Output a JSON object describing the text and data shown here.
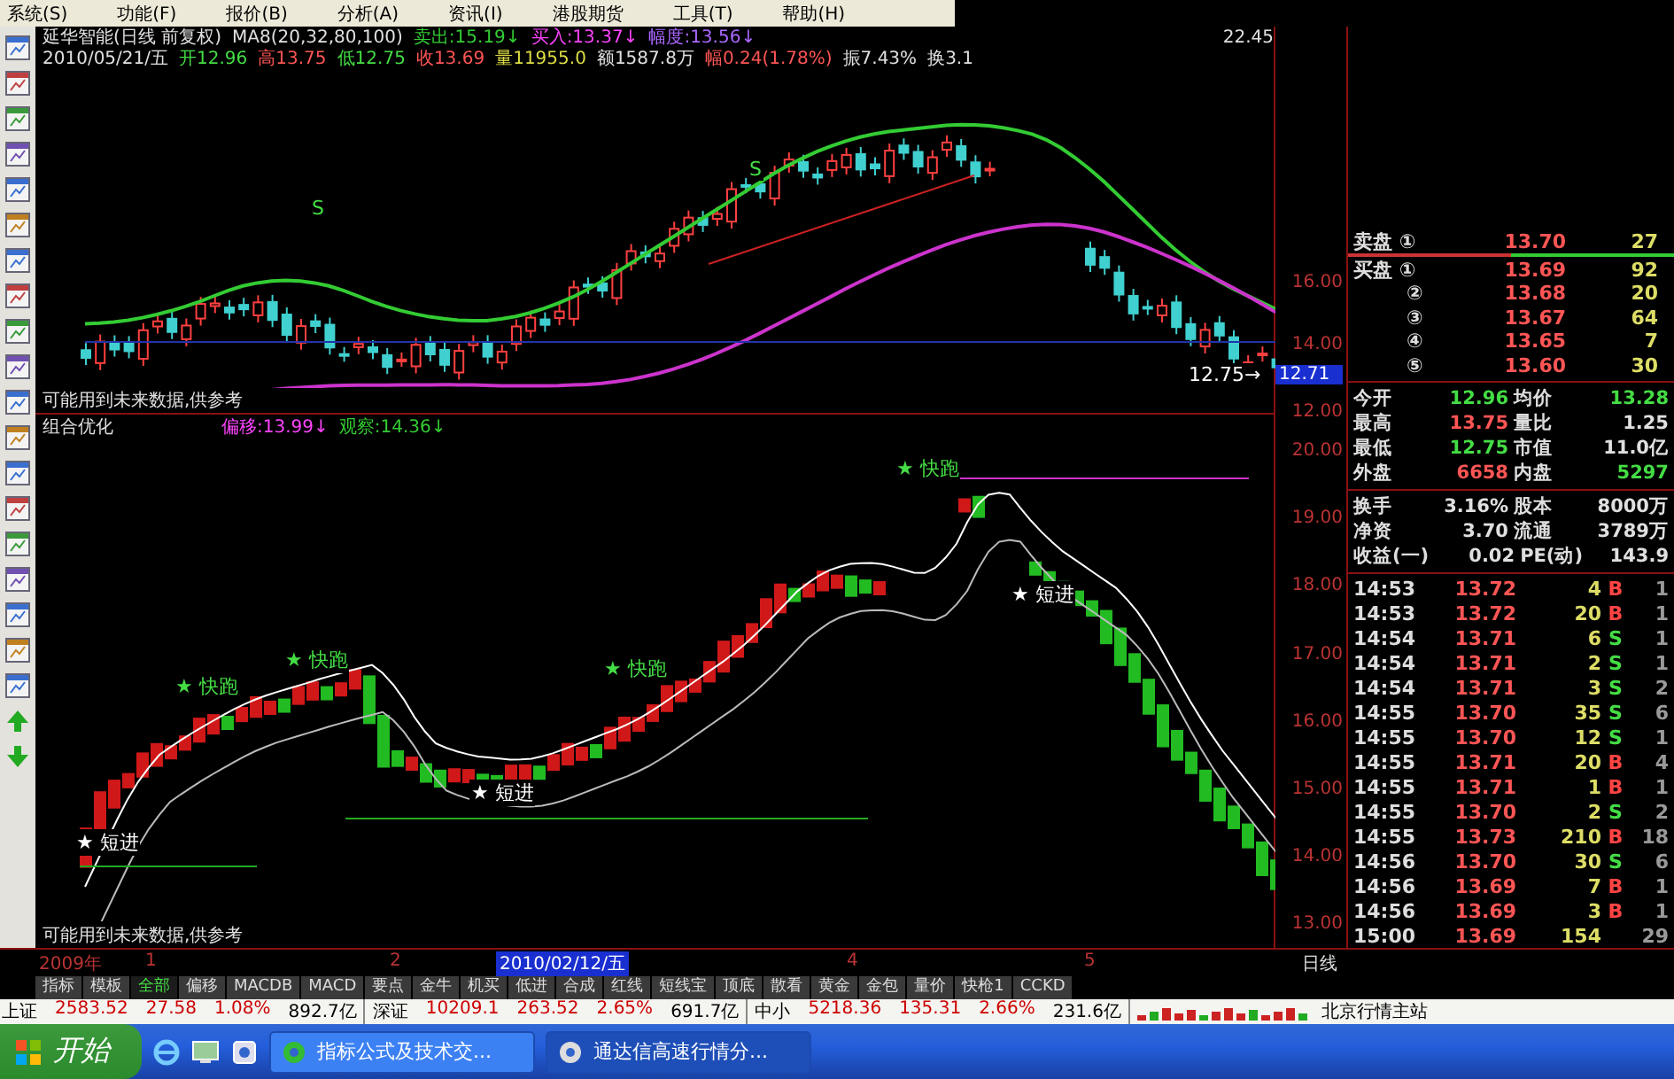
{
  "menu": [
    {
      "label": "系统(S)"
    },
    {
      "label": "功能(F)"
    },
    {
      "label": "报价(B)"
    },
    {
      "label": "分析(A)"
    },
    {
      "label": "资讯(I)"
    },
    {
      "label": "港股期货"
    },
    {
      "label": "工具(T)"
    },
    {
      "label": "帮助(H)"
    }
  ],
  "chart_header": {
    "title": "延华智能(日线 前复权)",
    "indicator": "MA8(20,32,80,100)",
    "signals": [
      {
        "label": "卖出:15.19↓",
        "color": "#33cc33"
      },
      {
        "label": "买入:13.37↓",
        "color": "#ff44ff"
      },
      {
        "label": "幅度:13.56↓",
        "color": "#aa66ff"
      }
    ],
    "time": "22.45"
  },
  "quote_line": [
    {
      "label": "2010/05/21/五",
      "color": "#e0e0e0"
    },
    {
      "label": "开12.96",
      "color": "#44dd44"
    },
    {
      "label": "高13.75",
      "color": "#ff5555"
    },
    {
      "label": "低12.75",
      "color": "#44dd44"
    },
    {
      "label": "收13.69",
      "color": "#ff5555"
    },
    {
      "label": "量11955.0",
      "color": "#dddd44"
    },
    {
      "label": "额1587.8万",
      "color": "#e0e0e0"
    },
    {
      "label": "幅0.24(1.78%)",
      "color": "#ff5555"
    },
    {
      "label": "振7.43%",
      "color": "#e0e0e0"
    },
    {
      "label": "换3.1",
      "color": "#e0e0e0"
    }
  ],
  "upper_chart": {
    "markers": [
      {
        "text": "S"
      },
      {
        "text": "S"
      },
      {
        "text": "12.75→"
      }
    ],
    "note": "可能用到未来数据,供参考"
  },
  "lower_chart": {
    "title": "组合优化",
    "signals": [
      {
        "label": "偏移:13.99↓",
        "color": "#ff44ff"
      },
      {
        "label": "观察:14.36↓",
        "color": "#33cc33"
      }
    ],
    "labels": [
      {
        "text": "★ 快跑",
        "kind": "run"
      },
      {
        "text": "★ 快跑",
        "kind": "run"
      },
      {
        "text": "★ 快跑",
        "kind": "run"
      },
      {
        "text": "★ 快跑",
        "kind": "run"
      },
      {
        "text": "★ 短进",
        "kind": "entry"
      },
      {
        "text": "★ 短进",
        "kind": "entry"
      },
      {
        "text": "★ 短进",
        "kind": "entry"
      }
    ],
    "note": "可能用到未来数据,供参考"
  },
  "price_axis": {
    "upper": [
      {
        "text": "16.00",
        "kind": "tick"
      },
      {
        "text": "14.00",
        "kind": "tick"
      },
      {
        "text": "12.71",
        "kind": "current"
      },
      {
        "text": "12.00",
        "kind": "tick"
      }
    ],
    "lower": [
      {
        "text": "20.00"
      },
      {
        "text": "19.00"
      },
      {
        "text": "18.00"
      },
      {
        "text": "17.00"
      },
      {
        "text": "16.00"
      },
      {
        "text": "15.00"
      },
      {
        "text": "14.00"
      },
      {
        "text": "13.00"
      }
    ]
  },
  "date_axis": [
    {
      "text": "2009年",
      "kind": "tick"
    },
    {
      "text": "1",
      "kind": "tick"
    },
    {
      "text": "2",
      "kind": "tick"
    },
    {
      "text": "2010/02/12/五",
      "kind": "cursor"
    },
    {
      "text": "4",
      "kind": "tick"
    },
    {
      "text": "5",
      "kind": "tick"
    },
    {
      "text": "日线",
      "kind": "period"
    }
  ],
  "tabs": [
    {
      "label": "指标",
      "selected": false
    },
    {
      "label": "模板",
      "selected": false
    },
    {
      "label": "全部",
      "selected": true
    },
    {
      "label": "偏移",
      "selected": false
    },
    {
      "label": "MACDB",
      "selected": false
    },
    {
      "label": "MACD",
      "selected": false
    },
    {
      "label": "要点",
      "selected": false
    },
    {
      "label": "金牛",
      "selected": false
    },
    {
      "label": "机买",
      "selected": false
    },
    {
      "label": "低进",
      "selected": false
    },
    {
      "label": "合成",
      "selected": false
    },
    {
      "label": "红线",
      "selected": false
    },
    {
      "label": "短线宝",
      "selected": false
    },
    {
      "label": "顶底",
      "selected": false
    },
    {
      "label": "散看",
      "selected": false
    },
    {
      "label": "黄金",
      "selected": false
    },
    {
      "label": "金包",
      "selected": false
    },
    {
      "label": "量价",
      "selected": false
    },
    {
      "label": "快枪1",
      "selected": false
    },
    {
      "label": "CCKD",
      "selected": false
    }
  ],
  "quote_panel": {
    "ask": {
      "side": "卖盘",
      "index": "①",
      "price": "13.70",
      "volume": "27"
    },
    "bids": [
      {
        "side": "买盘",
        "index": "①",
        "price": "13.69",
        "volume": "92"
      },
      {
        "index": "②",
        "price": "13.68",
        "volume": "20"
      },
      {
        "index": "③",
        "price": "13.67",
        "volume": "64"
      },
      {
        "index": "④",
        "price": "13.65",
        "volume": "7"
      },
      {
        "index": "⑤",
        "price": "13.60",
        "volume": "30"
      }
    ],
    "stats": [
      [
        {
          "label": "今开",
          "value": "12.96",
          "color": "#44dd44"
        },
        {
          "label": "均价",
          "value": "13.28",
          "color": "#44dd44"
        }
      ],
      [
        {
          "label": "最高",
          "value": "13.75",
          "color": "#ff5555"
        },
        {
          "label": "量比",
          "value": "1.25",
          "color": "#e0e0e0"
        }
      ],
      [
        {
          "label": "最低",
          "value": "12.75",
          "color": "#44dd44"
        },
        {
          "label": "市值",
          "value": "11.0亿",
          "color": "#e0e0e0"
        }
      ],
      [
        {
          "label": "外盘",
          "value": "6658",
          "color": "#ff5555"
        },
        {
          "label": "内盘",
          "value": "5297",
          "color": "#44dd44"
        }
      ]
    ],
    "fundamentals": [
      [
        {
          "label": "换手",
          "value": "3.16%"
        },
        {
          "label": "股本",
          "value": "8000万"
        }
      ],
      [
        {
          "label": "净资",
          "value": "3.70"
        },
        {
          "label": "流通",
          "value": "3789万"
        }
      ],
      [
        {
          "label": "收益(一)",
          "value": "0.02"
        },
        {
          "label": "PE(动)",
          "value": "143.9"
        }
      ]
    ]
  },
  "trades": [
    {
      "time": "14:53",
      "price": "13.72",
      "volume": "4",
      "side": "B",
      "kind": "buy",
      "count": "1"
    },
    {
      "time": "14:53",
      "price": "13.72",
      "volume": "20",
      "side": "B",
      "kind": "buy",
      "count": "1"
    },
    {
      "time": "14:54",
      "price": "13.71",
      "volume": "6",
      "side": "S",
      "kind": "sell",
      "count": "1"
    },
    {
      "time": "14:54",
      "price": "13.71",
      "volume": "2",
      "side": "S",
      "kind": "sell",
      "count": "1"
    },
    {
      "time": "14:54",
      "price": "13.71",
      "volume": "3",
      "side": "S",
      "kind": "sell",
      "count": "2"
    },
    {
      "time": "14:55",
      "price": "13.70",
      "volume": "35",
      "side": "S",
      "kind": "sell",
      "count": "6"
    },
    {
      "time": "14:55",
      "price": "13.70",
      "volume": "12",
      "side": "S",
      "kind": "sell",
      "count": "1"
    },
    {
      "time": "14:55",
      "price": "13.71",
      "volume": "20",
      "side": "B",
      "kind": "buy",
      "count": "4"
    },
    {
      "time": "14:55",
      "price": "13.71",
      "volume": "1",
      "side": "B",
      "kind": "buy",
      "count": "1"
    },
    {
      "time": "14:55",
      "price": "13.70",
      "volume": "2",
      "side": "S",
      "kind": "sell",
      "count": "2"
    },
    {
      "time": "14:55",
      "price": "13.73",
      "volume": "210",
      "side": "B",
      "kind": "buy",
      "count": "18"
    },
    {
      "time": "14:56",
      "price": "13.70",
      "volume": "30",
      "side": "S",
      "kind": "sell",
      "count": "6"
    },
    {
      "time": "14:56",
      "price": "13.69",
      "volume": "7",
      "side": "B",
      "kind": "buy",
      "count": "1"
    },
    {
      "time": "14:56",
      "price": "13.69",
      "volume": "3",
      "side": "B",
      "kind": "buy",
      "count": "1"
    },
    {
      "time": "15:00",
      "price": "13.69",
      "volume": "154",
      "kind": "close",
      "count": "29"
    }
  ],
  "status_bar": {
    "indices": [
      {
        "name": "上证",
        "value": "2583.52",
        "change": "27.58",
        "percent": "1.08%",
        "amount": "892.7亿"
      },
      {
        "name": "深证",
        "value": "10209.1",
        "change": "263.52",
        "percent": "2.65%",
        "amount": "691.7亿"
      },
      {
        "name": "中小",
        "value": "5218.36",
        "change": "135.31",
        "percent": "2.66%",
        "amount": "231.6亿"
      }
    ],
    "server": "北京行情主站"
  },
  "taskbar": {
    "start": "开始",
    "tasks": [
      {
        "label": "指标公式及技术交...",
        "selected": false
      },
      {
        "label": "通达信高速行情分...",
        "selected": true
      }
    ]
  }
}
